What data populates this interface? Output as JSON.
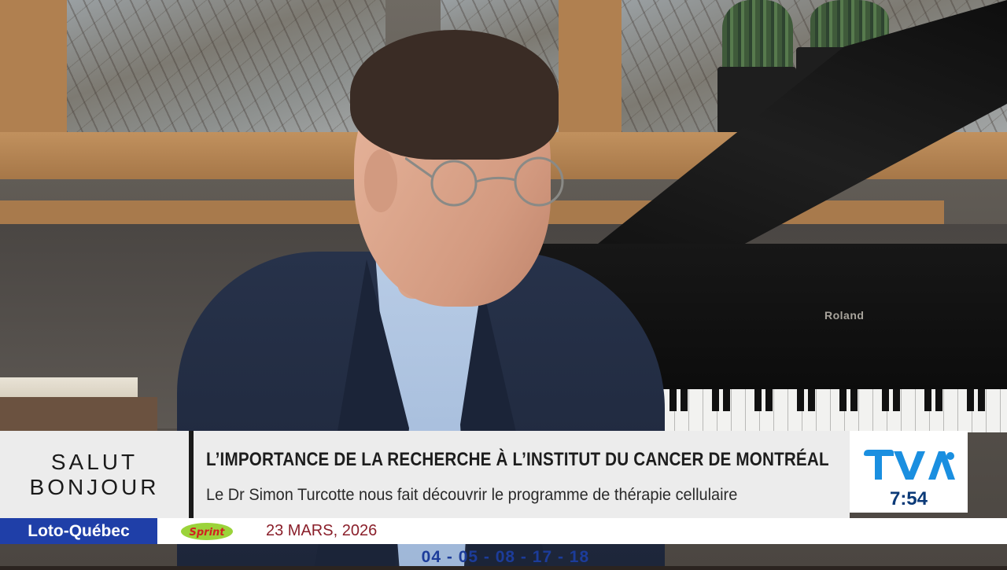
{
  "lower_third": {
    "show_name_line1": "SALUT",
    "show_name_line2": "BONJOUR",
    "headline": "L’IMPORTANCE DE LA RECHERCHE À L’INSTITUT DU CANCER DE MONTRÉAL",
    "subheadline": "Le Dr Simon Turcotte nous fait découvrir le programme de thérapie cellulaire"
  },
  "channel": {
    "logo": "TVA",
    "time": "7:54"
  },
  "ticker": {
    "sponsor": "Loto-Québec",
    "game_logo": "Sprint",
    "draw_date": "23 MARS, 2026",
    "numbers": [
      "04",
      "05",
      "08",
      "17",
      "18"
    ],
    "separator": " - "
  },
  "scene": {
    "piano_brand": "Roland"
  },
  "colors": {
    "tva_blue": "#1a8fe0",
    "loto_blue": "#1f3fa8",
    "numbers_blue": "#1c3c9a",
    "date_red": "#8a1f2a"
  }
}
